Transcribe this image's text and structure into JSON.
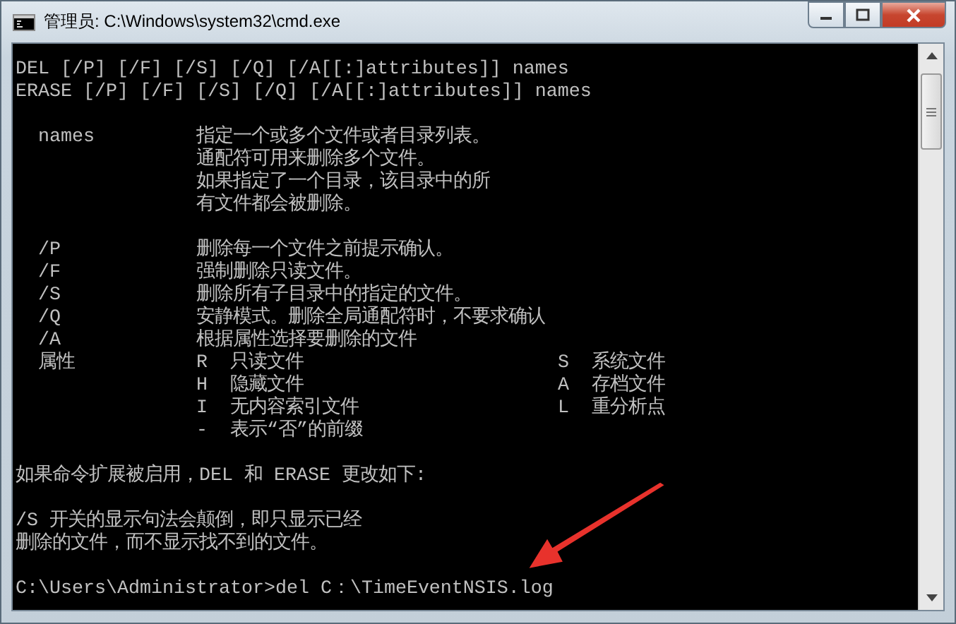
{
  "window": {
    "title": "管理员: C:\\Windows\\system32\\cmd.exe"
  },
  "console": {
    "lines": [
      {
        "kind": "text",
        "text": "DEL [/P] [/F] [/S] [/Q] [/A[[:]attributes]] names"
      },
      {
        "kind": "text",
        "text": "ERASE [/P] [/F] [/S] [/Q] [/A[[:]attributes]] names"
      },
      {
        "kind": "blank"
      },
      {
        "kind": "option",
        "switch": "names",
        "description": "指定一个或多个文件或者目录列表。"
      },
      {
        "kind": "option",
        "description": "通配符可用来删除多个文件。"
      },
      {
        "kind": "option",
        "description": "如果指定了一个目录，该目录中的所"
      },
      {
        "kind": "option",
        "description": "有文件都会被删除。"
      },
      {
        "kind": "blank"
      },
      {
        "kind": "option",
        "switch": "/P",
        "description": "删除每一个文件之前提示确认。"
      },
      {
        "kind": "option",
        "switch": "/F",
        "description": "强制删除只读文件。"
      },
      {
        "kind": "option",
        "switch": "/S",
        "description": "删除所有子目录中的指定的文件。"
      },
      {
        "kind": "option",
        "switch": "/Q",
        "description": "安静模式。删除全局通配符时，不要求确认"
      },
      {
        "kind": "option",
        "switch": "/A",
        "description": "根据属性选择要删除的文件"
      },
      {
        "kind": "attribute",
        "label": "属性",
        "code": "R",
        "meaning": "只读文件",
        "code_2": "S",
        "meaning_2": "系统文件"
      },
      {
        "kind": "attribute",
        "code": "H",
        "meaning": "隐藏文件",
        "code_2": "A",
        "meaning_2": "存档文件"
      },
      {
        "kind": "attribute",
        "code": "I",
        "meaning": "无内容索引文件",
        "code_2": "L",
        "meaning_2": "重分析点"
      },
      {
        "kind": "attribute",
        "code": "-",
        "meaning": "表示“否”的前缀"
      },
      {
        "kind": "blank"
      },
      {
        "kind": "text",
        "text": "如果命令扩展被启用，DEL 和 ERASE 更改如下:"
      },
      {
        "kind": "blank"
      },
      {
        "kind": "text",
        "text": "/S 开关的显示句法会颠倒，即只显示已经"
      },
      {
        "kind": "text",
        "text": "删除的文件，而不显示找不到的文件。"
      },
      {
        "kind": "blank"
      },
      {
        "kind": "text",
        "text": "C:\\Users\\Administrator>del C：\\TimeEventNSIS.log"
      }
    ]
  }
}
